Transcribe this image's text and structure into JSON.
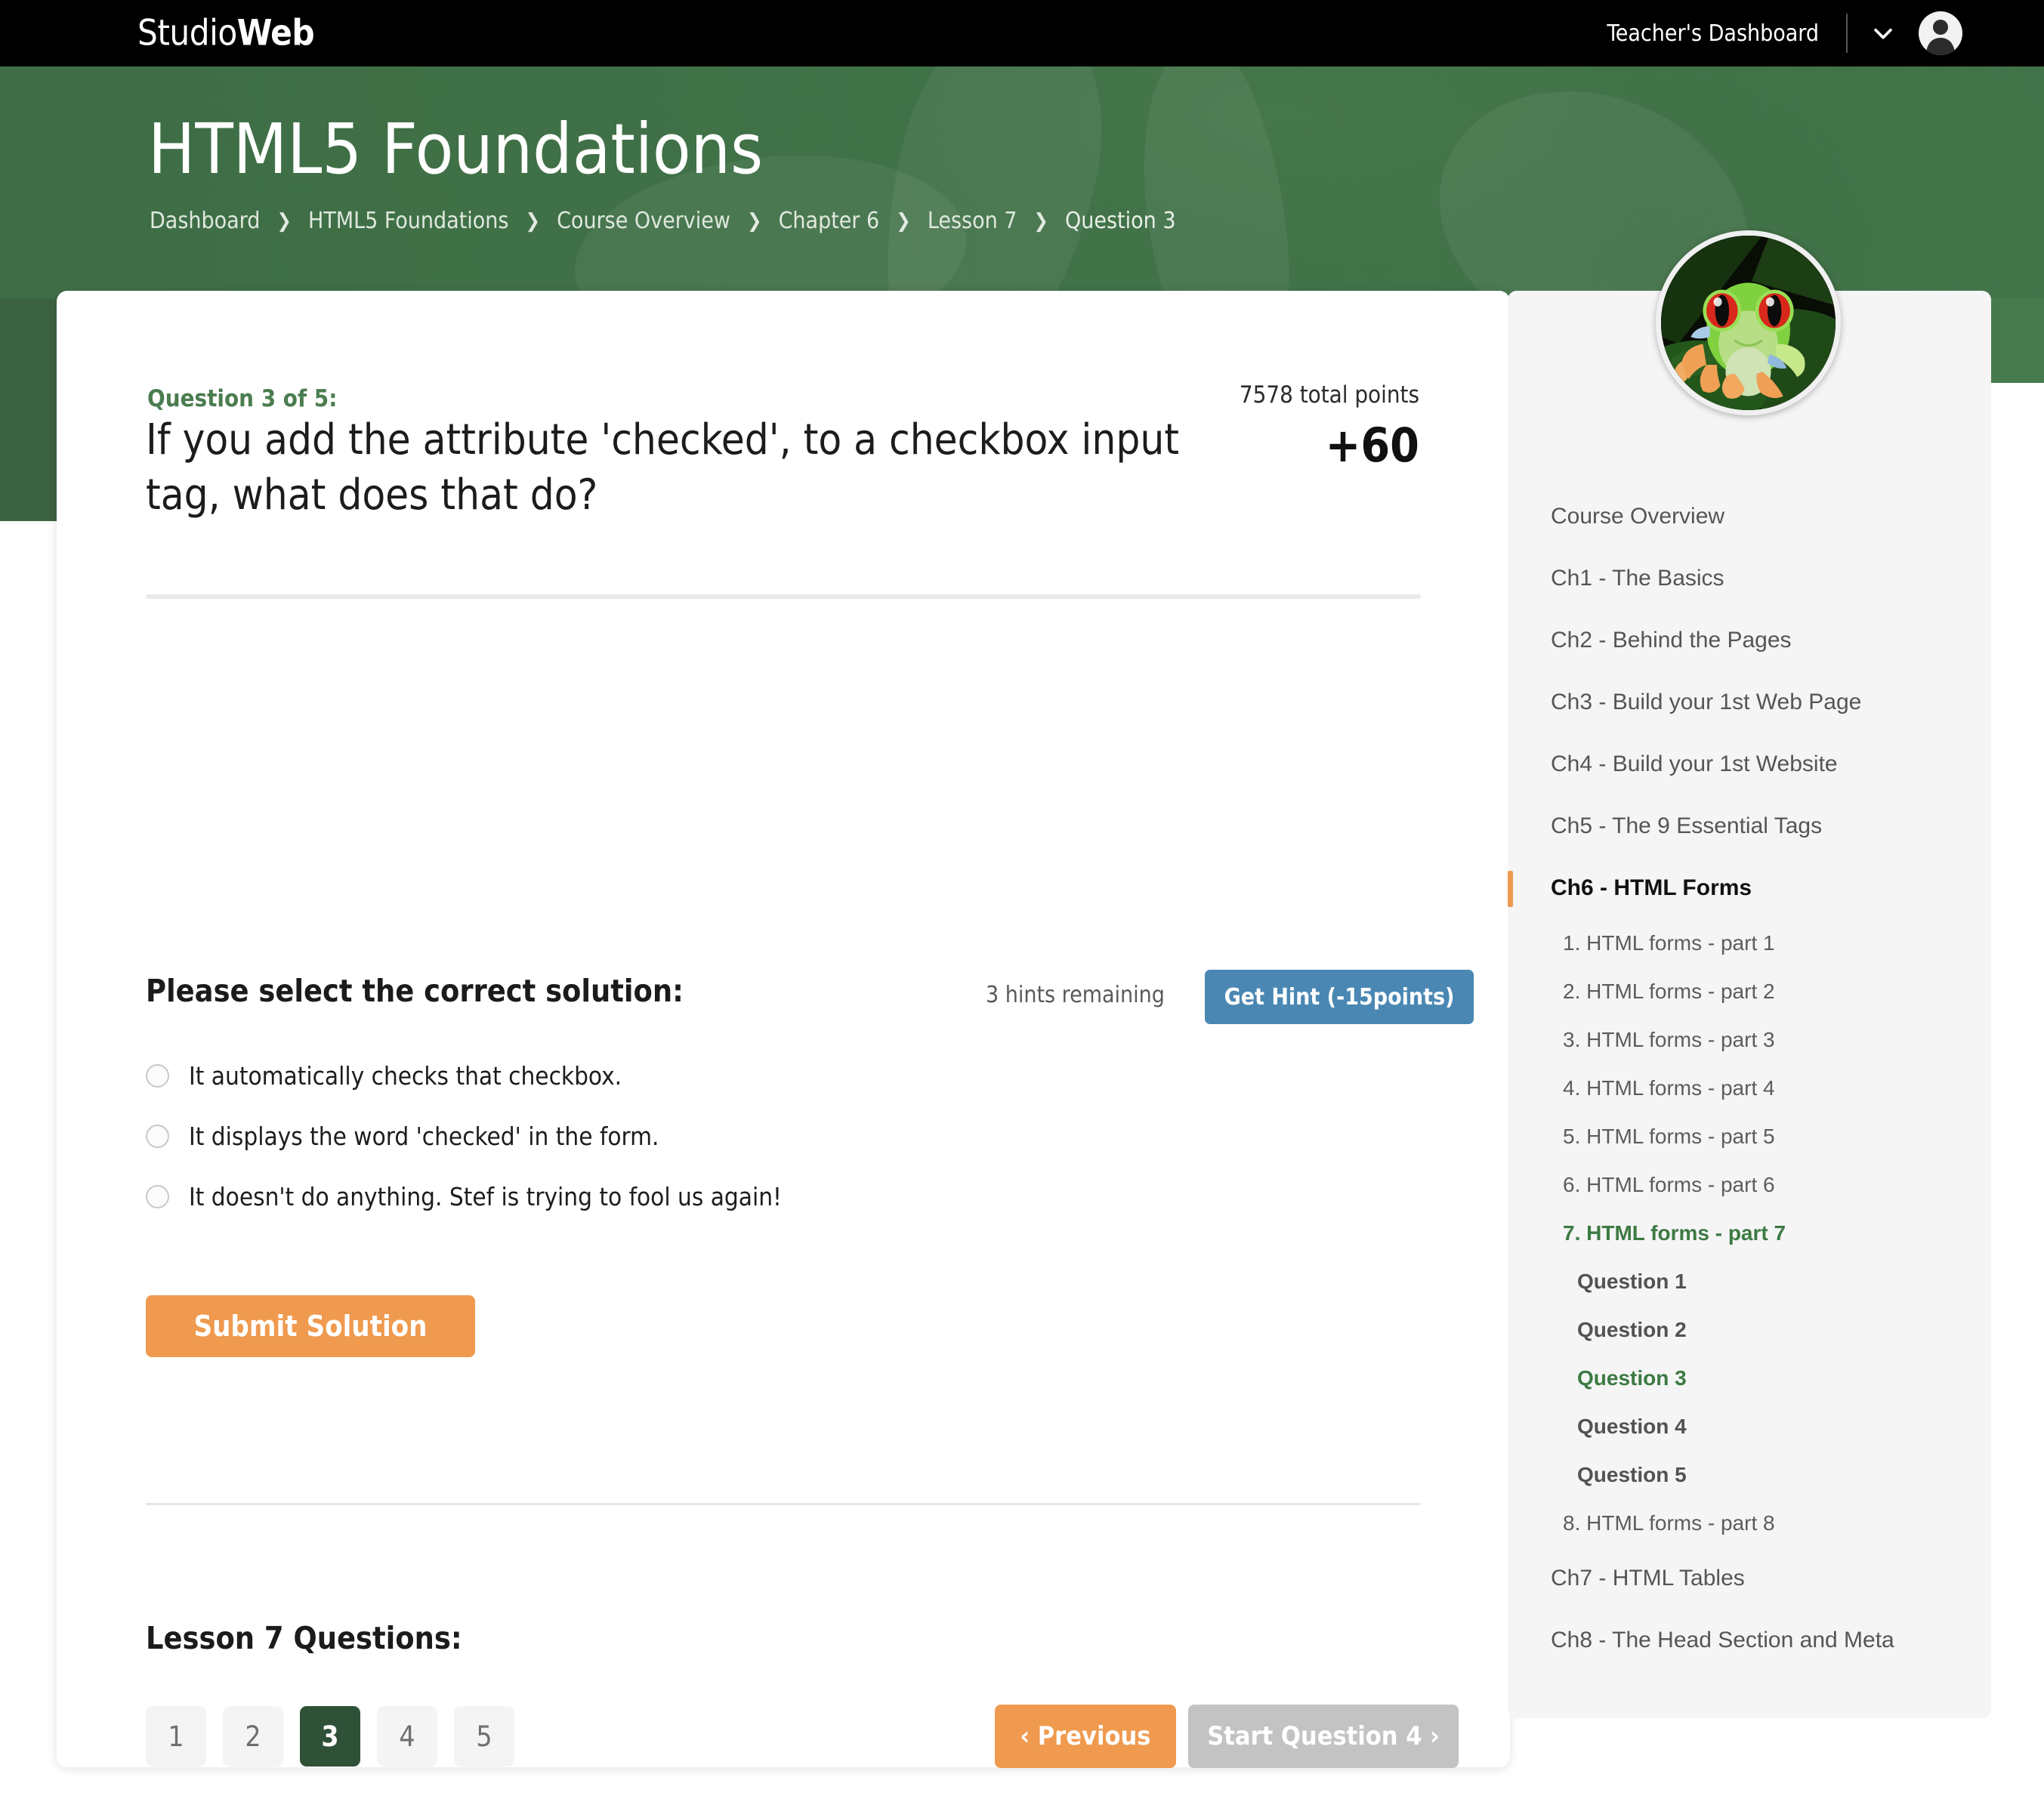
{
  "topnav": {
    "brand_light": "Studio",
    "brand_bold": "Web",
    "dashboard_label": "Teacher's Dashboard"
  },
  "hero": {
    "title": "HTML5 Foundations",
    "breadcrumb": [
      "Dashboard",
      "HTML5 Foundations",
      "Course Overview",
      "Chapter 6",
      "Lesson 7",
      "Question 3"
    ],
    "breadcrumb_separator": "❯"
  },
  "question": {
    "label": "Question 3 of 5:",
    "text": "If you add the attribute 'checked', to a checkbox input tag, what does that do?",
    "total_points": "7578 total points",
    "points_gain": "+60"
  },
  "solution": {
    "prompt": "Please select the correct solution:",
    "hints_remaining": "3 hints remaining",
    "hint_button": "Get Hint (-15points)",
    "options": [
      "It automatically checks that checkbox.",
      "It displays the word 'checked' in the form.",
      "It doesn't do anything. Stef is trying to fool us again!"
    ],
    "submit_button": "Submit Solution"
  },
  "pagination": {
    "label": "Lesson 7 Questions:",
    "pages": [
      "1",
      "2",
      "3",
      "4",
      "5"
    ],
    "active_page": "3",
    "previous_button": "‹ Previous",
    "next_button": "Start Question 4 ›"
  },
  "sidebar": {
    "items": [
      {
        "label": "Course Overview",
        "level": "chapter",
        "active": false
      },
      {
        "label": "Ch1 - The Basics",
        "level": "chapter",
        "active": false
      },
      {
        "label": "Ch2 - Behind the Pages",
        "level": "chapter",
        "active": false
      },
      {
        "label": "Ch3 - Build your 1st Web Page",
        "level": "chapter",
        "active": false
      },
      {
        "label": "Ch4 - Build your 1st Website",
        "level": "chapter",
        "active": false
      },
      {
        "label": "Ch5 - The 9 Essential Tags",
        "level": "chapter",
        "active": false
      },
      {
        "label": "Ch6 - HTML Forms",
        "level": "chapter",
        "active": true
      },
      {
        "label": "1. HTML forms - part 1",
        "level": "lesson",
        "active": false
      },
      {
        "label": "2. HTML forms - part 2",
        "level": "lesson",
        "active": false
      },
      {
        "label": "3. HTML forms - part 3",
        "level": "lesson",
        "active": false
      },
      {
        "label": "4. HTML forms - part 4",
        "level": "lesson",
        "active": false
      },
      {
        "label": "5. HTML forms - part 5",
        "level": "lesson",
        "active": false
      },
      {
        "label": "6. HTML forms - part 6",
        "level": "lesson",
        "active": false
      },
      {
        "label": "7. HTML forms - part 7",
        "level": "lesson",
        "active": true
      },
      {
        "label": "Question 1",
        "level": "question",
        "active": false
      },
      {
        "label": "Question 2",
        "level": "question",
        "active": false
      },
      {
        "label": "Question 3",
        "level": "question",
        "active": true
      },
      {
        "label": "Question 4",
        "level": "question",
        "active": false
      },
      {
        "label": "Question 5",
        "level": "question",
        "active": false
      },
      {
        "label": "8. HTML forms - part 8",
        "level": "lesson",
        "active": false
      },
      {
        "label": "Ch7 - HTML Tables",
        "level": "chapter",
        "active": false
      },
      {
        "label": "Ch8 - The Head Section and Meta",
        "level": "chapter",
        "active": false
      }
    ]
  },
  "colors": {
    "brand_green": "#3f6f47",
    "accent_orange": "#ef9a4f",
    "hint_blue": "#4a87b3",
    "active_page_green": "#2e5138",
    "link_green": "#3c7a43",
    "disabled_gray": "#c3c3c3"
  },
  "icons": {
    "user_avatar": "user-avatar-icon",
    "chevron_down": "chevron-down-icon",
    "profile_photo": "frog-profile-photo"
  }
}
